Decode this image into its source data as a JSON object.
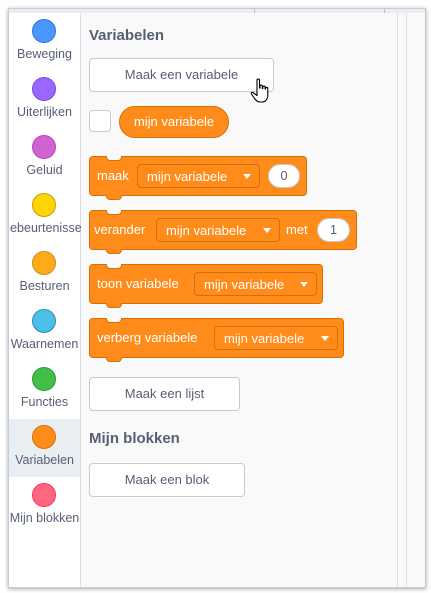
{
  "categories": [
    {
      "label": "Beweging",
      "color": "#4c97ff",
      "border": "#3373cc",
      "selected": false
    },
    {
      "label": "Uiterlijken",
      "color": "#9966ff",
      "border": "#774dcb",
      "selected": false
    },
    {
      "label": "Geluid",
      "color": "#cf63cf",
      "border": "#bd42bd",
      "selected": false
    },
    {
      "label": "Gebeurtenissen",
      "color": "#ffd500",
      "border": "#cc9900",
      "selected": false
    },
    {
      "label": "Besturen",
      "color": "#ffab19",
      "border": "#cf8b17",
      "selected": false
    },
    {
      "label": "Waarnemen",
      "color": "#4cbfe6",
      "border": "#2e8eb8",
      "selected": false
    },
    {
      "label": "Functies",
      "color": "#40bf4a",
      "border": "#389438",
      "selected": false
    },
    {
      "label": "Variabelen",
      "color": "#ff8c1a",
      "border": "#db6e00",
      "selected": true
    },
    {
      "label": "Mijn blokken",
      "color": "#ff6680",
      "border": "#ff3355",
      "selected": false
    }
  ],
  "palette": {
    "variables_heading": "Variabelen",
    "make_variable_button": "Maak een variabele",
    "variable_reporter": "mijn variabele",
    "blocks": {
      "set": {
        "label": "maak",
        "dropdown": "mijn variabele",
        "value": "0"
      },
      "change": {
        "label": "verander",
        "dropdown": "mijn variabele",
        "label2": "met",
        "value": "1"
      },
      "show": {
        "label": "toon variabele",
        "dropdown": "mijn variabele"
      },
      "hide": {
        "label": "verberg variabele",
        "dropdown": "mijn variabele"
      }
    },
    "make_list_button": "Maak een lijst",
    "my_blocks_heading": "Mijn blokken",
    "make_block_button": "Maak een blok"
  },
  "colors": {
    "variables": "#ff8c1a",
    "variables_border": "#db6e00",
    "text": "#575e75"
  }
}
